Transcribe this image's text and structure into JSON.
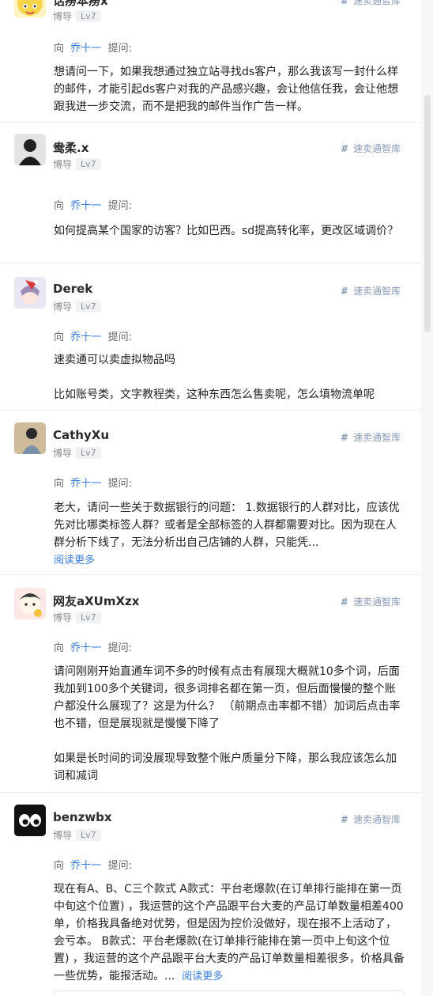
{
  "common": {
    "to_prefix": "向",
    "to_name": "乔十一",
    "to_suffix": "提问:",
    "tag_label": "速卖通智库",
    "role": "博导",
    "level": "Lv7",
    "read_more": "阅读更多"
  },
  "posts": [
    {
      "user": "话痨本痨x",
      "avatar_icon": "cartoon-avatar-icon",
      "paragraphs": [
        "想请问一下，如果我想通过独立站寻找ds客户，那么我该写一封什么样的邮件，才能引起ds客户对我的产品感兴趣，会让他信任我，会让他想跟我进一步交流，而不是把我的邮件当作广告一样。"
      ]
    },
    {
      "user": "鸯柔.x",
      "avatar_icon": "photo-avatar-icon",
      "paragraphs": [
        "如何提高某个国家的访客？比如巴西。sd提高转化率，更改区域调价？"
      ]
    },
    {
      "user": "Derek",
      "avatar_icon": "anime-avatar-icon",
      "paragraphs": [
        "速卖通可以卖虚拟物品吗",
        "",
        "比如账号类，文字教程类，这种东西怎么售卖呢，怎么填物流单呢"
      ]
    },
    {
      "user": "CathyXu",
      "avatar_icon": "photo-avatar-icon",
      "paragraphs": [
        "老大，请问一些关于数据银行的问题： 1.数据银行的人群对比，应该优先对比哪类标签人群？或者是全部标签的人群都需要对比。因为现在人群分析下线了，无法分析出自己店铺的人群，只能凭..."
      ],
      "read_more": true
    },
    {
      "user": "网友aXUmXzx",
      "avatar_icon": "cartoon-avatar-icon",
      "paragraphs": [
        "请问刚刚开始直通车词不多的时候有点击有展现大概就10多个词，后面我加到100多个关键词，很多词排名都在第一页，但后面慢慢的整个账户都没什么展现了？这是为什么？ （前期点击率都不错）加词后点击率也不错，但是展现就是慢慢下降了",
        "",
        "如果是长时间的词没展现导致整个账户质量分下降，那么我应该怎么加词和减词"
      ]
    },
    {
      "user": "benzwbx",
      "avatar_icon": "eyes-avatar-icon",
      "paragraphs": [
        "现在有A、B、C三个款式 A款式：平台老爆款(在订单排行能排在第一页中旬这个位置) ，我运营的这个产品跟平台大麦的产品订单数量相差400单，价格我具备绝对优势，但是因为控价没做好，现在报不上活动了，会亏本。 B款式：平台老爆款(在订单排行能排在第一页中上旬这个位置) ，我运营的这个产品跟平台大麦的产品订单数量相差很多，价格具备一些优势，能报活动。..."
      ],
      "read_more_inline": true
    }
  ]
}
